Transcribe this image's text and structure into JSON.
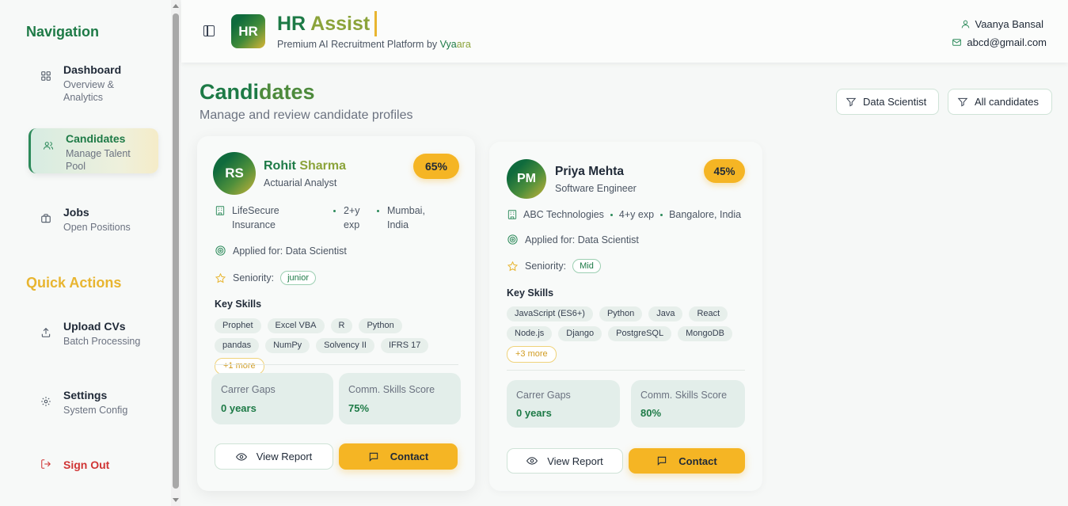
{
  "sidebar": {
    "nav_heading": "Navigation",
    "items": [
      {
        "title": "Dashboard",
        "subtitle": "Overview & Analytics"
      },
      {
        "title": "Candidates",
        "subtitle": "Manage Talent Pool"
      },
      {
        "title": "Jobs",
        "subtitle": "Open Positions"
      }
    ],
    "quick_heading": "Quick Actions",
    "quick_items": [
      {
        "title": "Upload CVs",
        "subtitle": "Batch Processing"
      },
      {
        "title": "Settings",
        "subtitle": "System Config"
      }
    ],
    "sign_out": "Sign Out"
  },
  "header": {
    "logo_text": "HR",
    "brand_a": "HR ",
    "brand_b": "Assist",
    "tagline": "Premium AI Recruitment Platform by ",
    "tagline_brand_a": "Vya",
    "tagline_brand_b": "ara",
    "user_name": "Vaanya Bansal",
    "user_email": "abcd@gmail.com"
  },
  "page": {
    "title_a": "Candi",
    "title_b": "dates",
    "subtitle": "Manage and review candidate profiles",
    "filters": [
      "Data Scientist",
      "All candidates"
    ]
  },
  "candidates": [
    {
      "initials": "RS",
      "first": "Rohit ",
      "last": "Sharma",
      "role": "Actuarial Analyst",
      "score": "65%",
      "company": "LifeSecure Insurance",
      "experience": "2+y exp",
      "location": "Mumbai, India",
      "applied_for": "Applied for: Data Scientist",
      "seniority_label": "Seniority:",
      "seniority": "junior",
      "skills_heading": "Key Skills",
      "skills": [
        "Prophet",
        "Excel VBA",
        "R",
        "Python",
        "pandas",
        "NumPy",
        "Solvency II",
        "IFRS 17"
      ],
      "more": "+1 more",
      "gaps_label": "Carrer Gaps",
      "gaps_value": "0 years",
      "comm_label": "Comm. Skills Score",
      "comm_value": "75%",
      "view_label": "View Report",
      "contact_label": "Contact"
    },
    {
      "initials": "PM",
      "name": "Priya Mehta",
      "role": "Software Engineer",
      "score": "45%",
      "company": "ABC Technologies",
      "experience": "4+y exp",
      "location": "Bangalore, India",
      "applied_for": "Applied for: Data Scientist",
      "seniority_label": "Seniority:",
      "seniority": "Mid",
      "skills_heading": "Key Skills",
      "skills": [
        "JavaScript (ES6+)",
        "Python",
        "Java",
        "React",
        "Node.js",
        "Django",
        "PostgreSQL",
        "MongoDB"
      ],
      "more": "+3 more",
      "gaps_label": "Carrer Gaps",
      "gaps_value": "0 years",
      "comm_label": "Comm. Skills Score",
      "comm_value": "80%",
      "view_label": "View Report",
      "contact_label": "Contact"
    }
  ]
}
